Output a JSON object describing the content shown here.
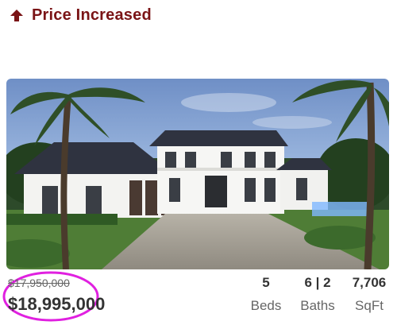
{
  "banner": {
    "text": "Price Increased",
    "icon": "arrow-up-icon",
    "color": "#7a1416"
  },
  "listing": {
    "old_price": "$17,950,000",
    "new_price": "$18,995,000",
    "highlight_color": "#e020e0",
    "beds": {
      "value": "5",
      "label": "Beds"
    },
    "baths": {
      "value": "6 | 2",
      "label": "Baths"
    },
    "sqft": {
      "value": "7,706",
      "label": "SqFt"
    }
  }
}
